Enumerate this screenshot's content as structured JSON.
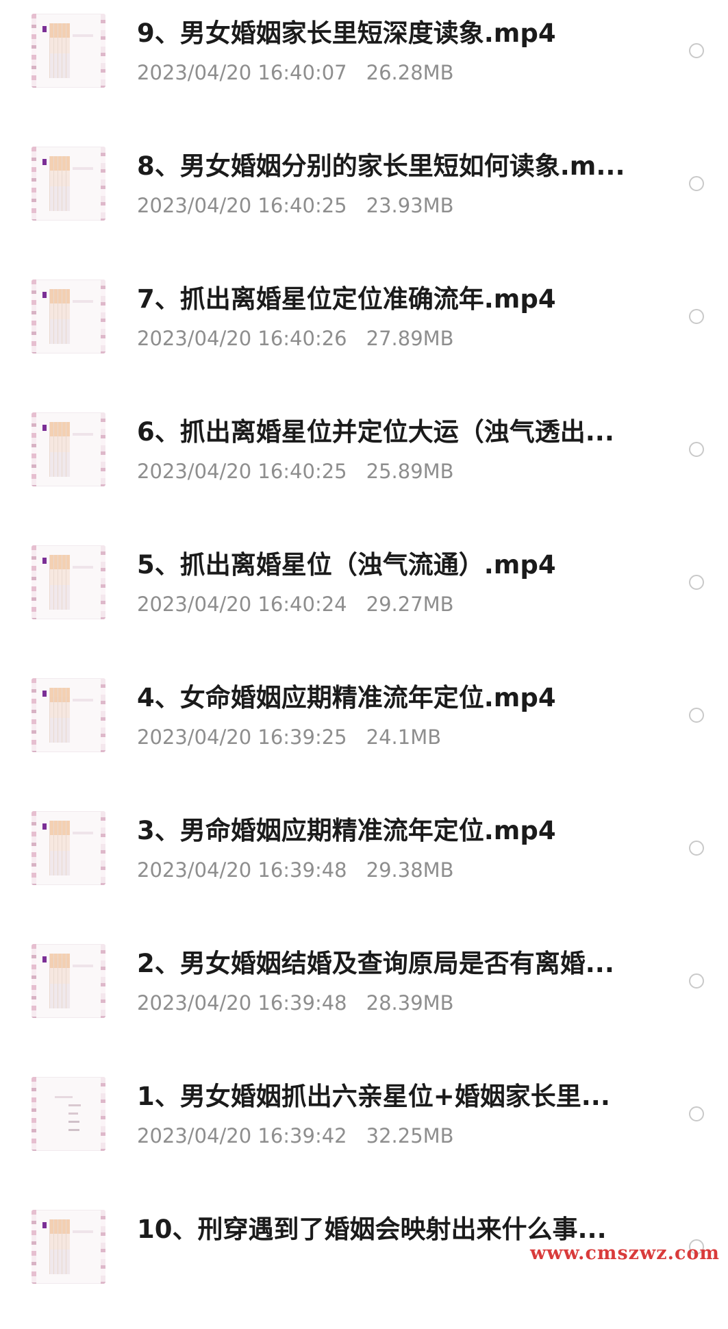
{
  "files": [
    {
      "name": "9、男女婚姻家长里短深度读象.mp4",
      "date": "2023/04/20 16:40:07",
      "size": "26.28MB"
    },
    {
      "name": "8、男女婚姻分别的家长里短如何读象.m...",
      "date": "2023/04/20 16:40:25",
      "size": "23.93MB"
    },
    {
      "name": "7、抓出离婚星位定位准确流年.mp4",
      "date": "2023/04/20 16:40:26",
      "size": "27.89MB"
    },
    {
      "name": "6、抓出离婚星位并定位大运（浊气透出...",
      "date": "2023/04/20 16:40:25",
      "size": "25.89MB"
    },
    {
      "name": "5、抓出离婚星位（浊气流通）.mp4",
      "date": "2023/04/20 16:40:24",
      "size": "29.27MB"
    },
    {
      "name": "4、女命婚姻应期精准流年定位.mp4",
      "date": "2023/04/20 16:39:25",
      "size": "24.1MB"
    },
    {
      "name": "3、男命婚姻应期精准流年定位.mp4",
      "date": "2023/04/20 16:39:48",
      "size": "29.38MB"
    },
    {
      "name": "2、男女婚姻结婚及查询原局是否有离婚...",
      "date": "2023/04/20 16:39:48",
      "size": "28.39MB"
    },
    {
      "name": "1、男女婚姻抓出六亲星位+婚姻家长里...",
      "date": "2023/04/20 16:39:42",
      "size": "32.25MB"
    },
    {
      "name": "10、刑穿遇到了婚姻会映射出来什么事..."
    }
  ],
  "watermark": "www.cmszwz.com",
  "colors": {
    "title": "#1b1b1b",
    "meta": "#8e8e8e",
    "radio_border": "#c9c9c9",
    "watermark": "#d93b3b"
  }
}
